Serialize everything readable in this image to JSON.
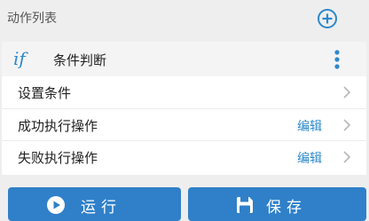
{
  "header": {
    "title": "动作列表",
    "add_icon": "plus-circle-icon"
  },
  "action_card": {
    "icon": "if-icon",
    "icon_text": "if",
    "title": "条件判断",
    "more_icon": "more-vertical-icon",
    "rows": [
      {
        "label": "设置条件",
        "link": ""
      },
      {
        "label": "成功执行操作",
        "link": "编辑"
      },
      {
        "label": "失败执行操作",
        "link": "编辑"
      }
    ]
  },
  "footer": {
    "run_label": "运行",
    "run_icon": "play-circle-icon",
    "save_label": "保存",
    "save_icon": "floppy-disk-icon"
  },
  "colors": {
    "accent": "#2f80c9",
    "link": "#2c89cc",
    "background": "#eeeeee"
  }
}
